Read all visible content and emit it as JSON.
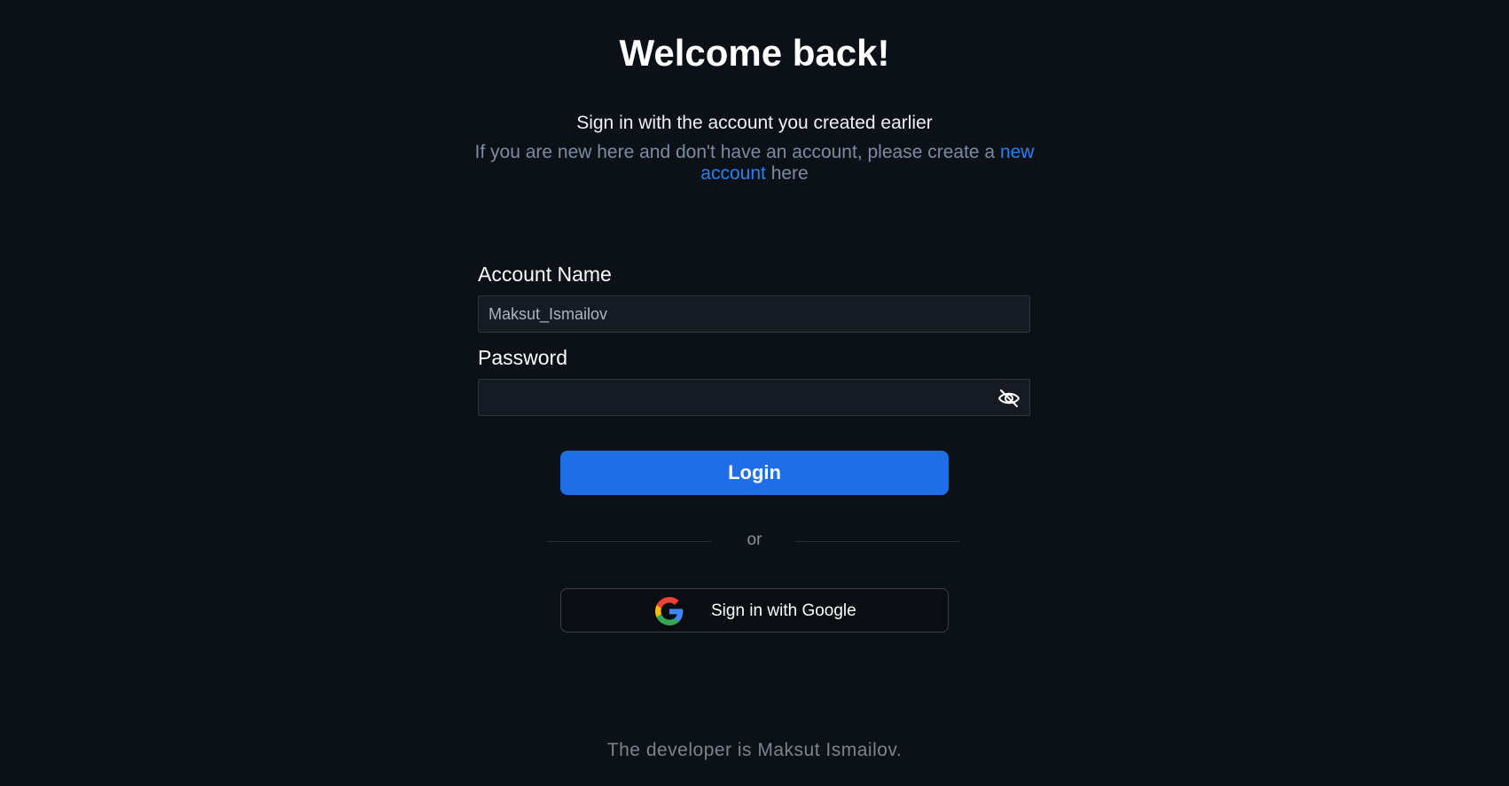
{
  "heading": {
    "title": "Welcome back!",
    "subtitle": "Sign in with the account you created earlier",
    "note_prefix": "If you are new here and don't have an account, please create a",
    "note_link": "new account",
    "note_suffix": "here"
  },
  "form": {
    "account_label": "Account Name",
    "account_value": "Maksut_Ismailov",
    "password_label": "Password",
    "password_value": "",
    "password_toggle_icon": "eye-off-icon",
    "login_label": "Login",
    "divider_text": "or",
    "google_label": "Sign in with Google",
    "google_icon": "google-icon"
  },
  "footer": {
    "text": "The developer is Maksut Ismailov."
  },
  "colors": {
    "background": "#0c1017",
    "accent": "#1f6ee8",
    "link": "#2d7ff0",
    "muted": "#7d8ba1"
  }
}
